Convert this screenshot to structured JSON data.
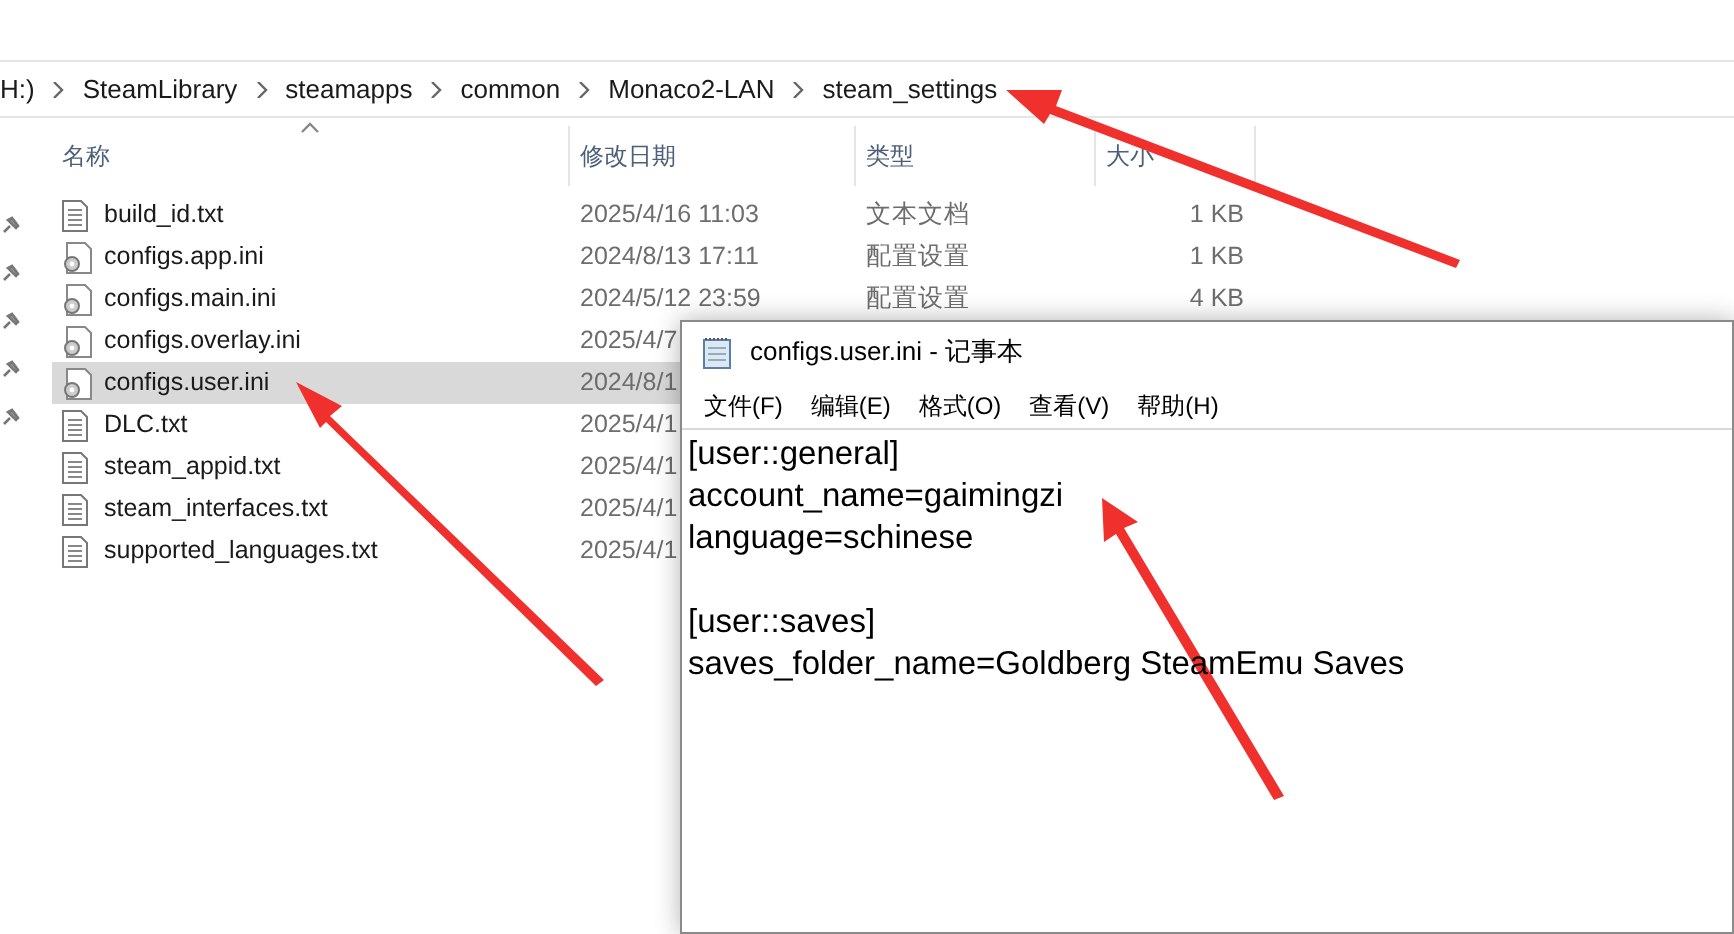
{
  "explorer": {
    "breadcrumb": [
      "H:)",
      "SteamLibrary",
      "steamapps",
      "common",
      "Monaco2-LAN",
      "steam_settings"
    ],
    "columns": [
      {
        "label": "名称",
        "sorted": true
      },
      {
        "label": "修改日期",
        "sorted": false
      },
      {
        "label": "类型",
        "sorted": false
      },
      {
        "label": "大小",
        "sorted": false
      }
    ],
    "rows": [
      {
        "kind": "text",
        "name": "build_id.txt",
        "date": "2025/4/16 11:03",
        "type": "文本文档",
        "size": "1 KB",
        "selected": false
      },
      {
        "kind": "config",
        "name": "configs.app.ini",
        "date": "2024/8/13 17:11",
        "type": "配置设置",
        "size": "1 KB",
        "selected": false
      },
      {
        "kind": "config",
        "name": "configs.main.ini",
        "date": "2024/5/12 23:59",
        "type": "配置设置",
        "size": "4 KB",
        "selected": false
      },
      {
        "kind": "config",
        "name": "configs.overlay.ini",
        "date": "2025/4/7",
        "selected": false
      },
      {
        "kind": "config",
        "name": "configs.user.ini",
        "date": "2024/8/1",
        "selected": true
      },
      {
        "kind": "text",
        "name": "DLC.txt",
        "date": "2025/4/1",
        "selected": false
      },
      {
        "kind": "text",
        "name": "steam_appid.txt",
        "date": "2025/4/1",
        "selected": false
      },
      {
        "kind": "text",
        "name": "steam_interfaces.txt",
        "date": "2025/4/1",
        "selected": false
      },
      {
        "kind": "text",
        "name": "supported_languages.txt",
        "date": "2025/4/1",
        "selected": false
      }
    ]
  },
  "notepad": {
    "title": "configs.user.ini - 记事本",
    "menu": [
      "文件(F)",
      "编辑(E)",
      "格式(O)",
      "查看(V)",
      "帮助(H)"
    ],
    "sections": [
      {
        "lines": [
          "[user::general]",
          "account_name=gaimingzi",
          "language=schinese"
        ]
      },
      {
        "lines": [
          "[user::saves]",
          "saves_folder_name=Goldberg SteamEmu Saves"
        ]
      }
    ]
  }
}
